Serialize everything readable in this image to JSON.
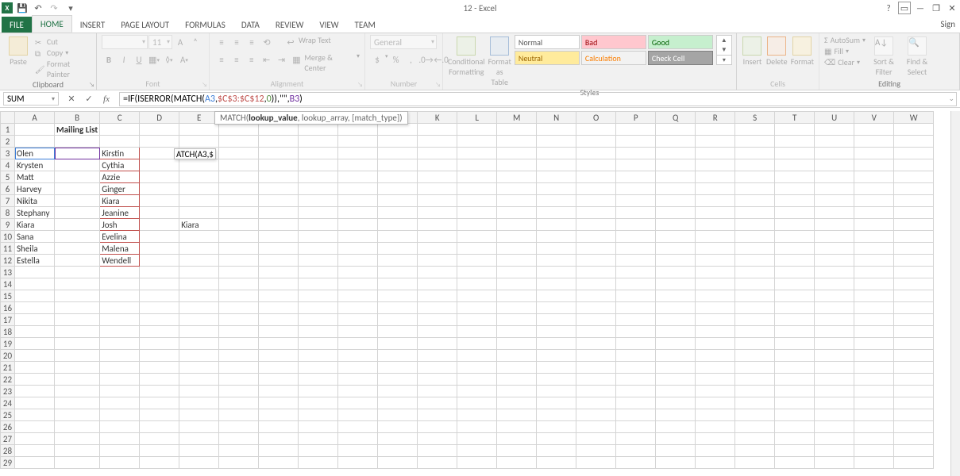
{
  "titlebar": {
    "doc": "12 - Excel"
  },
  "tabs": {
    "file": "FILE",
    "home": "HOME",
    "insert": "INSERT",
    "page_layout": "PAGE LAYOUT",
    "formulas": "FORMULAS",
    "data": "DATA",
    "review": "REVIEW",
    "view": "VIEW",
    "team": "TEAM",
    "signin": "Sign"
  },
  "ribbon": {
    "clipboard": {
      "paste": "Paste",
      "cut": "Cut",
      "copy": "Copy",
      "painter": "Format Painter",
      "label": "Clipboard"
    },
    "font": {
      "name": "",
      "size": "11",
      "label": "Font",
      "bold": "B",
      "italic": "I",
      "underline": "U"
    },
    "alignment": {
      "wrap": "Wrap Text",
      "merge": "Merge & Center",
      "label": "Alignment"
    },
    "number": {
      "format": "General",
      "label": "Number",
      "currency": "$",
      "percent": "%",
      "comma": ",",
      "inc": "",
      "dec": ""
    },
    "cond": {
      "cond": "Conditional Formatting",
      "fat": "Format as Table",
      "label": "Styles"
    },
    "styles": {
      "normal": "Normal",
      "bad": "Bad",
      "good": "Good",
      "neutral": "Neutral",
      "calc": "Calculation",
      "check": "Check Cell"
    },
    "cells": {
      "insert": "Insert",
      "delete": "Delete",
      "format": "Format",
      "label": "Cells"
    },
    "editing": {
      "autosum": "AutoSum",
      "fill": "Fill",
      "clear": "Clear",
      "sort": "Sort & Filter",
      "find": "Find & Select",
      "label": "Editing"
    }
  },
  "fbar": {
    "namebox": "SUM",
    "formula_prefix": "=IF(ISERROR(MATCH(",
    "formula_a3": "A3",
    "formula_c1": ",",
    "formula_range": "$C$3:$C$12",
    "formula_c2": ",",
    "formula_zero": "0",
    "formula_mid": ")),\"\",",
    "formula_b3": "B3",
    "formula_end": ")"
  },
  "tooltip": {
    "fn": "MATCH(",
    "p1": "lookup_value",
    "rest": ", lookup_array, [match_type])"
  },
  "cols": [
    "A",
    "B",
    "C",
    "D",
    "E",
    "F",
    "G",
    "H",
    "I",
    "J",
    "K",
    "L",
    "M",
    "N",
    "O",
    "P",
    "Q",
    "R",
    "S",
    "T",
    "U",
    "V",
    "W"
  ],
  "rows": {
    "header_title": "Mailing List",
    "r2_blank": "",
    "A": [
      "Olen",
      "Krysten",
      "Matt",
      "Harvey",
      "Nikita",
      "Stephany",
      "Kiara",
      "Sana",
      "Sheila",
      "Estella"
    ],
    "C": [
      "Kirstin",
      "Cythia",
      "Azzie",
      "Ginger",
      "Kiara",
      "Jeanine",
      "Josh",
      "Evelina",
      "Malena",
      "Wendell"
    ],
    "E9": "Kiara",
    "E3_edit": "ATCH(A3,$"
  },
  "nrows": 29
}
